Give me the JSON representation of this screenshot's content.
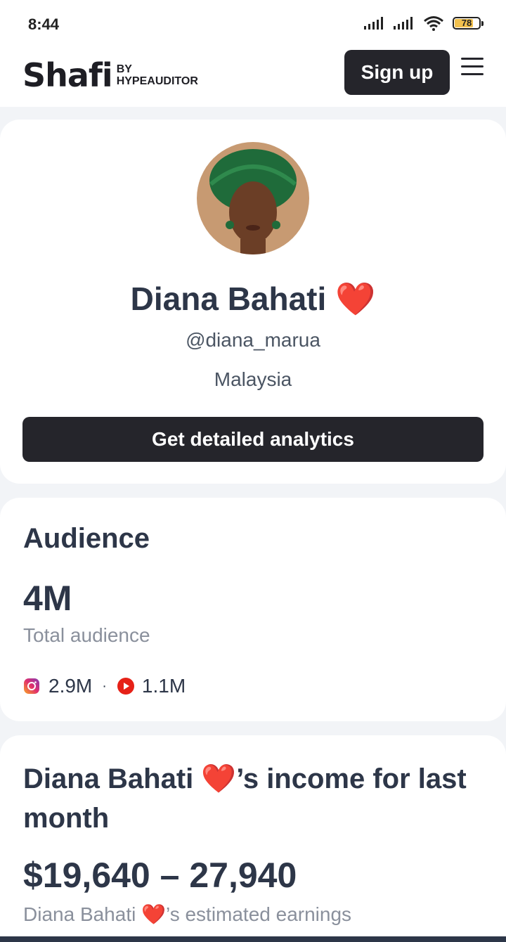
{
  "status_bar": {
    "time": "8:44",
    "battery": "78",
    "battery_level": 0.78
  },
  "header": {
    "logo_text": "Shafi",
    "logo_by": "BY",
    "logo_sub": "HYPEAUDITOR",
    "signup_label": "Sign up"
  },
  "profile": {
    "name": "Diana Bahati ❤️",
    "handle": "@diana_marua",
    "country": "Malaysia",
    "cta_label": "Get detailed analytics"
  },
  "audience": {
    "title": "Audience",
    "total": "4M",
    "total_label": "Total audience",
    "instagram": "2.9M",
    "separator": "·",
    "youtube": "1.1M"
  },
  "income": {
    "title": "Diana Bahati ❤️’s income for last month",
    "range": "$19,640 – 27,940",
    "caption": "Diana Bahati ❤️’s estimated earnings"
  },
  "colors": {
    "dark_button": "#25252b",
    "text_primary": "#2d3648",
    "text_muted": "#8a909c",
    "page_bg": "#f2f4f7"
  }
}
